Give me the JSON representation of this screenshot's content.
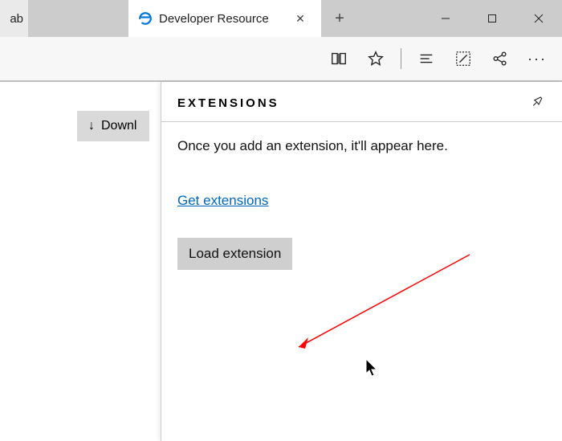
{
  "titlebar": {
    "partial_tab_text": "ab",
    "active_tab_title": "Developer Resource",
    "new_tab_label": "+",
    "minimize_label": "Minimize",
    "maximize_label": "Maximize",
    "close_label": "Close"
  },
  "toolbar": {
    "reading_label": "Reading view",
    "favorites_label": "Favorites",
    "hub_label": "Hub",
    "notes_label": "Web Note",
    "share_label": "Share",
    "more_label": "More"
  },
  "page": {
    "download_label": "Downl"
  },
  "panel": {
    "title": "EXTENSIONS",
    "pin_label": "Pin",
    "message": "Once you add an extension, it'll appear here.",
    "get_link": "Get extensions",
    "load_button": "Load extension"
  }
}
